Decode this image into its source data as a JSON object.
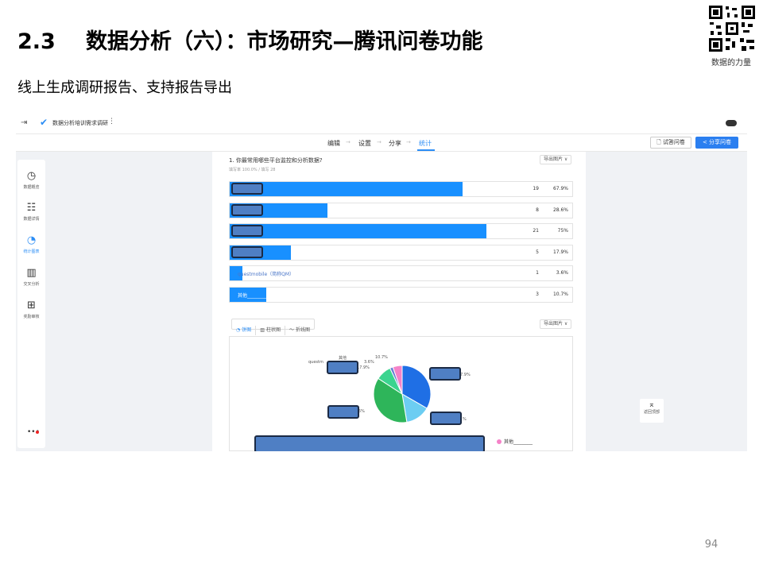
{
  "slide": {
    "section_number": "2.3",
    "title": "数据分析（六）：市场研究—腾讯问卷功能",
    "subtitle": "线上生成调研报告、支持报告导出",
    "qr_caption": "数据的力量",
    "page_number": "94"
  },
  "app": {
    "back_icon": "⇥",
    "logo_icon": "✔",
    "survey_name": "数据分析培训需求调研",
    "more_icon": "⋮",
    "steps": [
      {
        "label": "编辑",
        "active": false
      },
      {
        "label": "设置",
        "active": false
      },
      {
        "label": "分享",
        "active": false
      },
      {
        "label": "统计",
        "active": true
      }
    ],
    "step_separator": "→",
    "preview_button": "试答问卷",
    "preview_icon": "🗋",
    "share_button": "分享问卷",
    "share_icon": "<",
    "sidebar": [
      {
        "icon": "◷",
        "icon_name": "dashboard-icon",
        "label": "数据概览",
        "active": false
      },
      {
        "icon": "☷",
        "icon_name": "details-icon",
        "label": "数据详情",
        "active": false
      },
      {
        "icon": "◔",
        "icon_name": "pie-chart-icon",
        "label": "统计图表",
        "active": true
      },
      {
        "icon": "▥",
        "icon_name": "bar-chart-icon",
        "label": "交叉分析",
        "active": false
      },
      {
        "icon": "⊞",
        "icon_name": "gift-icon",
        "label": "奖励审核",
        "active": false
      }
    ],
    "sidebar_more": "•••",
    "back_to_top_icon": "⌅",
    "back_to_top_label": "返回顶部"
  },
  "question": {
    "title": "1. 你最常用哪些平台监控和分析数据?",
    "meta": "填写率 100.0% / 填写 28",
    "export_label": "导出图片 ∨",
    "options": [
      {
        "label": "",
        "count": "19",
        "pct": "67.9%",
        "value": 0.679,
        "redacted": true
      },
      {
        "label": "",
        "count": "8",
        "pct": "28.6%",
        "value": 0.286,
        "redacted": true
      },
      {
        "label": "",
        "count": "21",
        "pct": "75%",
        "value": 0.75,
        "redacted": true
      },
      {
        "label": "",
        "count": "5",
        "pct": "17.9%",
        "value": 0.179,
        "redacted": true
      },
      {
        "label": "questmobile（简称QM）",
        "count": "1",
        "pct": "3.6%",
        "value": 0.036,
        "redacted": false
      },
      {
        "label": "其他________",
        "count": "3",
        "pct": "10.7%",
        "value": 0.107,
        "redacted": false
      }
    ]
  },
  "chart_tabs": [
    {
      "icon": "◔",
      "label": "饼图",
      "active": true
    },
    {
      "icon": "▥",
      "label": "柱状图",
      "active": false
    },
    {
      "icon": "〜",
      "label": "折线图",
      "active": false
    }
  ],
  "chart_data": {
    "type": "pie",
    "slices": [
      {
        "label": "",
        "percent": 67.9,
        "color": "#1f6fe5"
      },
      {
        "label": "",
        "percent": 28.6,
        "color": "#6ccdf2"
      },
      {
        "label": "",
        "percent": 75.0,
        "color": "#2eb55a"
      },
      {
        "label": "",
        "percent": 17.9,
        "color": "#3bd48f"
      },
      {
        "label": "questmobile",
        "percent": 3.6,
        "color": "#6a7fd6"
      },
      {
        "label": "其他",
        "percent": 10.7,
        "color": "#f582c8"
      }
    ],
    "annotations": [
      "其他",
      "10.7%",
      "questm",
      "3.6%",
      "17.9%",
      "7.9%",
      "5%",
      "%"
    ],
    "legend": [
      {
        "label": "其他________",
        "color": "#f582c8"
      }
    ]
  }
}
